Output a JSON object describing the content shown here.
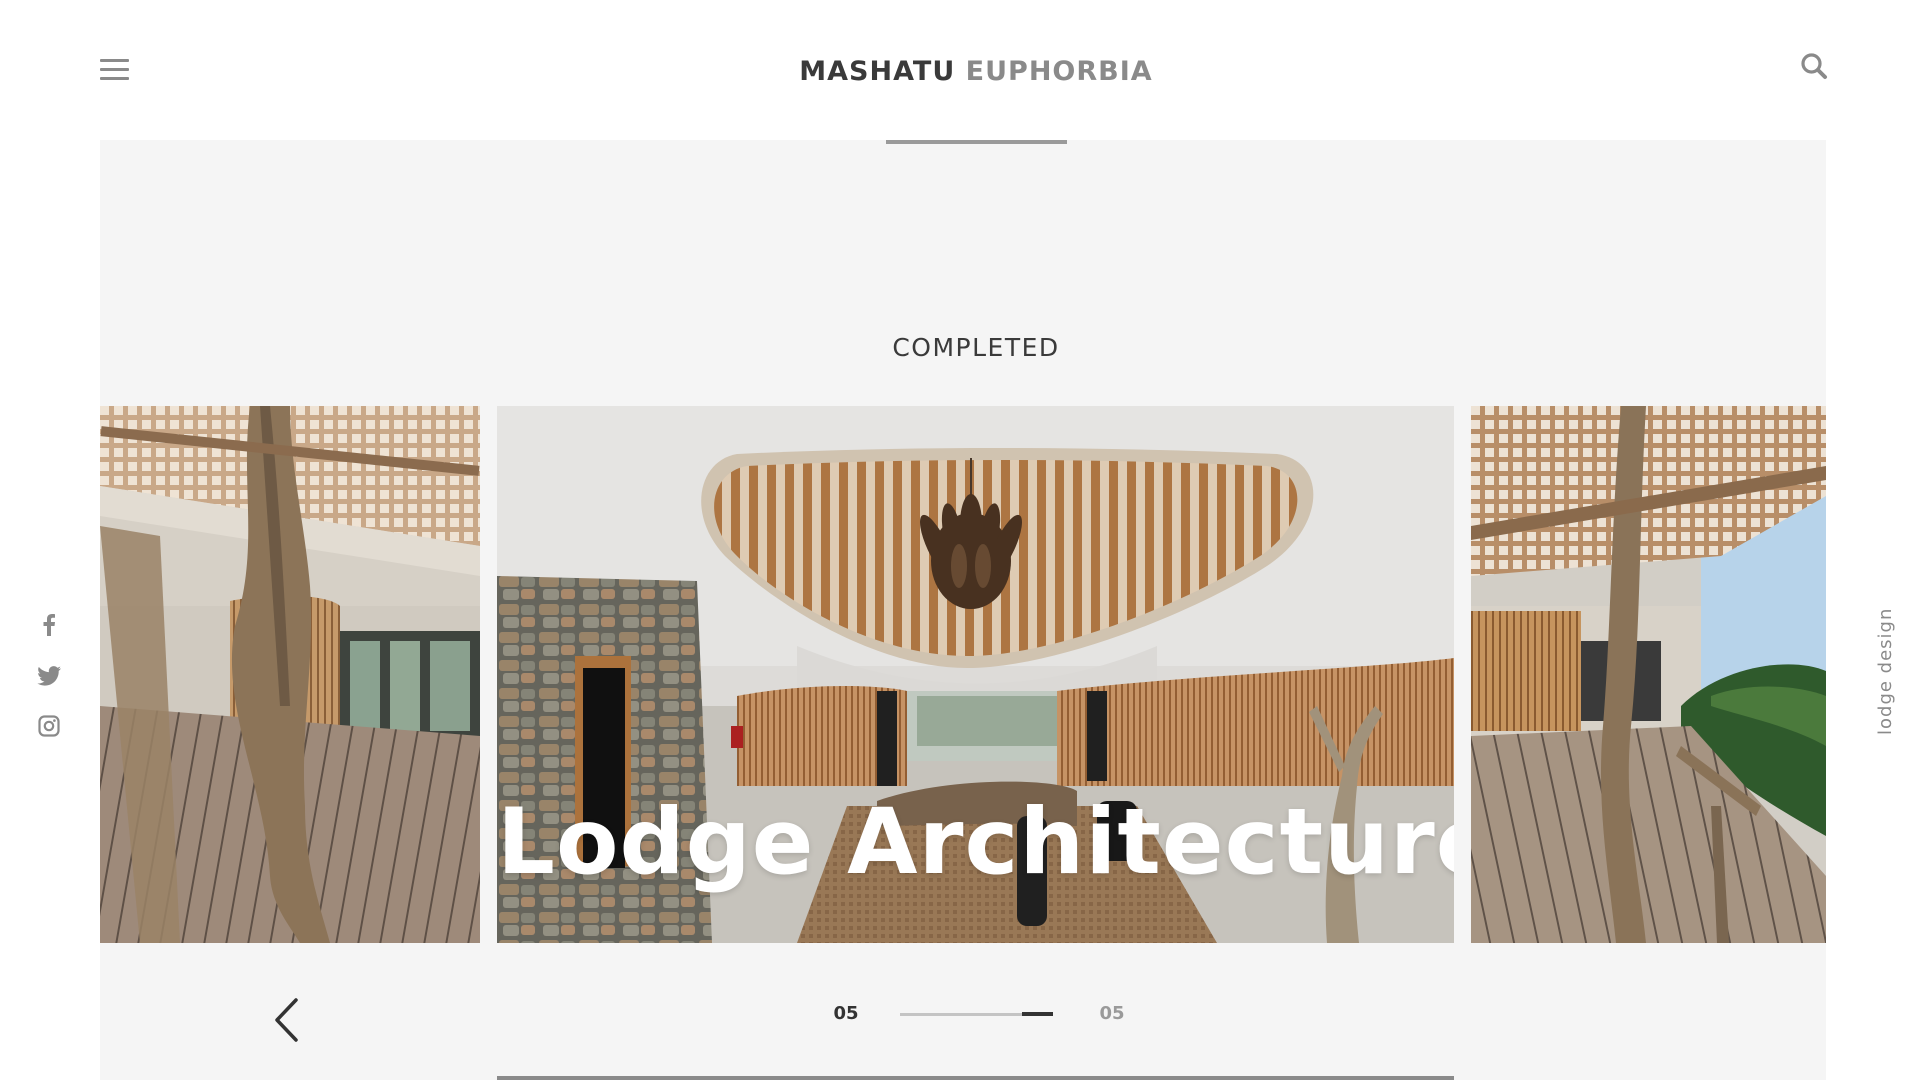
{
  "header": {
    "brand_primary": "MASHATU",
    "brand_secondary": "EUPHORBIA",
    "menu_icon": "hamburger-menu-icon",
    "search_icon": "search-icon"
  },
  "section": {
    "label": "COMPLETED"
  },
  "slides": [
    {
      "title": ""
    },
    {
      "title": "Lodge Architecture"
    },
    {
      "title": ""
    }
  ],
  "social": [
    {
      "icon": "facebook-icon"
    },
    {
      "icon": "twitter-icon"
    },
    {
      "icon": "instagram-icon"
    }
  ],
  "side_label": "lodge design",
  "pager": {
    "current": "05",
    "total": "05",
    "progress": 0.2,
    "prev_icon": "chevron-left-icon"
  },
  "colors": {
    "accent_dark": "#333333",
    "muted": "#8a8a8a",
    "panel_bg": "#f5f5f5"
  }
}
